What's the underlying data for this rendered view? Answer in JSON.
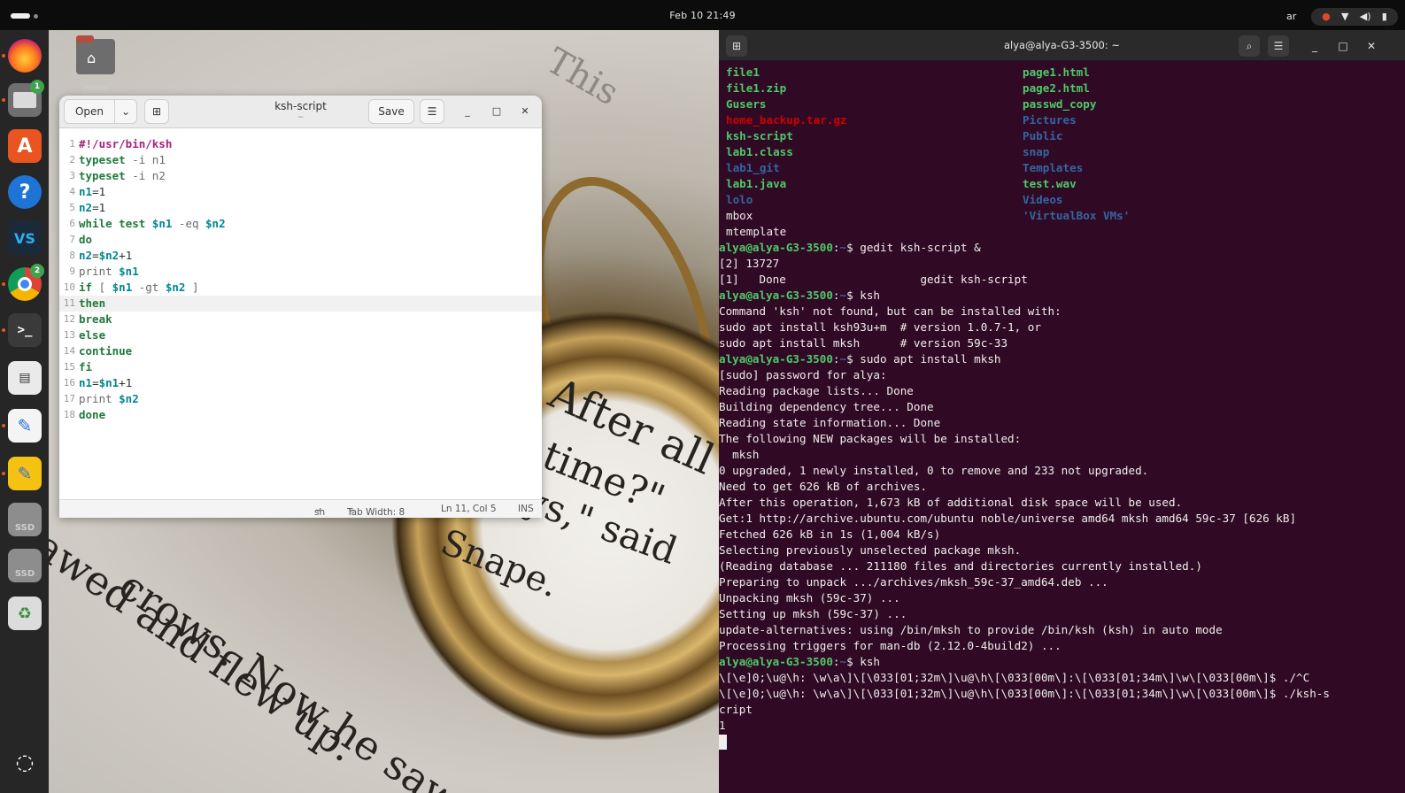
{
  "topbar": {
    "clock": "Feb 10  21:49",
    "lang": "ar"
  },
  "desktop": {
    "home_label": "Home"
  },
  "dock": {
    "items": [
      {
        "name": "firefox-icon",
        "color": "#e66000"
      },
      {
        "name": "files-icon",
        "badge": "1"
      },
      {
        "name": "app-center-icon"
      },
      {
        "name": "help-icon"
      },
      {
        "name": "vscode-icon"
      },
      {
        "name": "chrome-icon",
        "badge": "2"
      },
      {
        "name": "terminal-icon"
      },
      {
        "name": "document-viewer-icon"
      },
      {
        "name": "text-editor-icon"
      },
      {
        "name": "notes-icon"
      },
      {
        "name": "ssd-drive-icon-1",
        "label": "SSD"
      },
      {
        "name": "ssd-drive-icon-2",
        "label": "SSD"
      },
      {
        "name": "trash-icon"
      },
      {
        "name": "show-apps-icon"
      }
    ]
  },
  "wallpaper": {
    "lines": [
      "After all",
      "time?\"",
      "ys,\" said",
      "Snape.",
      "crows. Now he saw",
      "awed and flew up.",
      "This"
    ]
  },
  "gedit": {
    "open_label": "Open",
    "save_label": "Save",
    "title": "ksh-script",
    "subtitle": "~",
    "status": {
      "language": "sh",
      "tab_width": "Tab Width: 8",
      "position": "Ln 11, Col 5",
      "mode": "INS"
    },
    "lines": [
      [
        {
          "t": "#!/usr/bin/ksh",
          "c": "sb"
        }
      ],
      [
        {
          "t": "typeset",
          "c": "kw"
        },
        {
          "t": " -i n1",
          "c": "op"
        }
      ],
      [
        {
          "t": "typeset",
          "c": "kw"
        },
        {
          "t": " -i n2",
          "c": "op"
        }
      ],
      [
        {
          "t": "n1",
          "c": "vr"
        },
        {
          "t": "=1",
          "c": "pl"
        }
      ],
      [
        {
          "t": "n2",
          "c": "vr"
        },
        {
          "t": "=1",
          "c": "pl"
        }
      ],
      [
        {
          "t": "while",
          "c": "kw"
        },
        {
          "t": " ",
          "c": "pl"
        },
        {
          "t": "test",
          "c": "kw"
        },
        {
          "t": " ",
          "c": "pl"
        },
        {
          "t": "$n1",
          "c": "vr"
        },
        {
          "t": " -eq ",
          "c": "op"
        },
        {
          "t": "$n2",
          "c": "vr"
        }
      ],
      [
        {
          "t": "do",
          "c": "kw"
        }
      ],
      [
        {
          "t": "n2",
          "c": "vr"
        },
        {
          "t": "=",
          "c": "pl"
        },
        {
          "t": "$n2",
          "c": "vr"
        },
        {
          "t": "+1",
          "c": "pl"
        }
      ],
      [
        {
          "t": "print ",
          "c": "op"
        },
        {
          "t": "$n1",
          "c": "vr"
        }
      ],
      [
        {
          "t": "if",
          "c": "kw"
        },
        {
          "t": " [ ",
          "c": "op"
        },
        {
          "t": "$n1",
          "c": "vr"
        },
        {
          "t": " -gt ",
          "c": "op"
        },
        {
          "t": "$n2",
          "c": "vr"
        },
        {
          "t": " ]",
          "c": "op"
        }
      ],
      [
        {
          "t": "then",
          "c": "kw"
        }
      ],
      [
        {
          "t": "break",
          "c": "kw"
        }
      ],
      [
        {
          "t": "else",
          "c": "kw"
        }
      ],
      [
        {
          "t": "continue",
          "c": "kw"
        }
      ],
      [
        {
          "t": "fi",
          "c": "kw"
        }
      ],
      [
        {
          "t": "n1",
          "c": "vr"
        },
        {
          "t": "=",
          "c": "pl"
        },
        {
          "t": "$n1",
          "c": "vr"
        },
        {
          "t": "+1",
          "c": "pl"
        }
      ],
      [
        {
          "t": "print ",
          "c": "op"
        },
        {
          "t": "$n2",
          "c": "vr"
        }
      ],
      [
        {
          "t": "done",
          "c": "kw"
        }
      ]
    ],
    "current_line": 11
  },
  "terminal": {
    "title": "alya@alya-G3-3500: ~",
    "listing": [
      [
        {
          "t": "file1",
          "c": "t-green"
        },
        {
          "t": "page1.html",
          "c": "t-green"
        }
      ],
      [
        {
          "t": "file1.zip",
          "c": "t-green"
        },
        {
          "t": "page2.html",
          "c": "t-green"
        }
      ],
      [
        {
          "t": "Gusers",
          "c": "t-green"
        },
        {
          "t": "passwd_copy",
          "c": "t-green"
        }
      ],
      [
        {
          "t": "home_backup.tar.gz",
          "c": "t-red"
        },
        {
          "t": "Pictures",
          "c": "t-blue"
        }
      ],
      [
        {
          "t": "ksh-script",
          "c": "t-green"
        },
        {
          "t": "Public",
          "c": "t-blue"
        }
      ],
      [
        {
          "t": "lab1.class",
          "c": "t-green"
        },
        {
          "t": "snap",
          "c": "t-blue"
        }
      ],
      [
        {
          "t": "lab1_git",
          "c": "t-blue"
        },
        {
          "t": "Templates",
          "c": "t-blue"
        }
      ],
      [
        {
          "t": "lab1.java",
          "c": "t-green"
        },
        {
          "t": "test.wav",
          "c": "t-green"
        }
      ],
      [
        {
          "t": "lolo",
          "c": "t-blue"
        },
        {
          "t": "Videos",
          "c": "t-blue"
        }
      ],
      [
        {
          "t": "mbox",
          "c": "t-white"
        },
        {
          "t": "'VirtualBox VMs'",
          "c": "t-blue"
        }
      ],
      [
        {
          "t": "mtemplate",
          "c": "t-white"
        },
        {
          "t": "",
          "c": "t-white"
        }
      ]
    ],
    "lines": [
      [
        {
          "t": "alya@alya-G3-3500",
          "c": "t-green"
        },
        {
          "t": ":",
          "c": "t-white"
        },
        {
          "t": "~",
          "c": "t-blue"
        },
        {
          "t": "$ gedit ksh-script &",
          "c": "t-white"
        }
      ],
      [
        {
          "t": "[2] 13727",
          "c": "t-white"
        }
      ],
      [
        {
          "t": "[1]   Done                    gedit ksh-script",
          "c": "t-white"
        }
      ],
      [
        {
          "t": "alya@alya-G3-3500",
          "c": "t-green"
        },
        {
          "t": ":",
          "c": "t-white"
        },
        {
          "t": "~",
          "c": "t-blue"
        },
        {
          "t": "$ ksh",
          "c": "t-white"
        }
      ],
      [
        {
          "t": "Command 'ksh' not found, but can be installed with:",
          "c": "t-white"
        }
      ],
      [
        {
          "t": "sudo apt install ksh93u+m  # version 1.0.7-1, or",
          "c": "t-white"
        }
      ],
      [
        {
          "t": "sudo apt install mksh      # version 59c-33",
          "c": "t-white"
        }
      ],
      [
        {
          "t": "alya@alya-G3-3500",
          "c": "t-green"
        },
        {
          "t": ":",
          "c": "t-white"
        },
        {
          "t": "~",
          "c": "t-blue"
        },
        {
          "t": "$ sudo apt install mksh",
          "c": "t-white"
        }
      ],
      [
        {
          "t": "[sudo] password for alya:",
          "c": "t-white"
        }
      ],
      [
        {
          "t": "Reading package lists... Done",
          "c": "t-white"
        }
      ],
      [
        {
          "t": "Building dependency tree... Done",
          "c": "t-white"
        }
      ],
      [
        {
          "t": "Reading state information... Done",
          "c": "t-white"
        }
      ],
      [
        {
          "t": "The following NEW packages will be installed:",
          "c": "t-white"
        }
      ],
      [
        {
          "t": "  mksh",
          "c": "t-white"
        }
      ],
      [
        {
          "t": "0 upgraded, 1 newly installed, 0 to remove and 233 not upgraded.",
          "c": "t-white"
        }
      ],
      [
        {
          "t": "Need to get 626 kB of archives.",
          "c": "t-white"
        }
      ],
      [
        {
          "t": "After this operation, 1,673 kB of additional disk space will be used.",
          "c": "t-white"
        }
      ],
      [
        {
          "t": "Get:1 http://archive.ubuntu.com/ubuntu noble/universe amd64 mksh amd64 59c-37 [626 kB]",
          "c": "t-white"
        }
      ],
      [
        {
          "t": "Fetched 626 kB in 1s (1,004 kB/s)",
          "c": "t-white"
        }
      ],
      [
        {
          "t": "Selecting previously unselected package mksh.",
          "c": "t-white"
        }
      ],
      [
        {
          "t": "(Reading database ... 211180 files and directories currently installed.)",
          "c": "t-white"
        }
      ],
      [
        {
          "t": "Preparing to unpack .../archives/mksh_59c-37_amd64.deb ...",
          "c": "t-white"
        }
      ],
      [
        {
          "t": "Unpacking mksh (59c-37) ...",
          "c": "t-white"
        }
      ],
      [
        {
          "t": "Setting up mksh (59c-37) ...",
          "c": "t-white"
        }
      ],
      [
        {
          "t": "update-alternatives: using /bin/mksh to provide /bin/ksh (ksh) in auto mode",
          "c": "t-white"
        }
      ],
      [
        {
          "t": "Processing triggers for man-db (2.12.0-4build2) ...",
          "c": "t-white"
        }
      ],
      [
        {
          "t": "alya@alya-G3-3500",
          "c": "t-green"
        },
        {
          "t": ":",
          "c": "t-white"
        },
        {
          "t": "~",
          "c": "t-blue"
        },
        {
          "t": "$ ksh",
          "c": "t-white"
        }
      ],
      [
        {
          "t": "\\[\\e]0;\\u@\\h: \\w\\a\\]\\[\\033[01;32m\\]\\u@\\h\\[\\033[00m\\]:\\[\\033[01;34m\\]\\w\\[\\033[00m\\]$ ./^C",
          "c": "t-white"
        }
      ],
      [
        {
          "t": "\\[\\e]0;\\u@\\h: \\w\\a\\]\\[\\033[01;32m\\]\\u@\\h\\[\\033[00m\\]:\\[\\033[01;34m\\]\\w\\[\\033[00m\\]$ ./ksh-s",
          "c": "t-white"
        }
      ],
      [
        {
          "t": "cript",
          "c": "t-white"
        }
      ],
      [
        {
          "t": "1",
          "c": "t-white"
        }
      ]
    ]
  }
}
